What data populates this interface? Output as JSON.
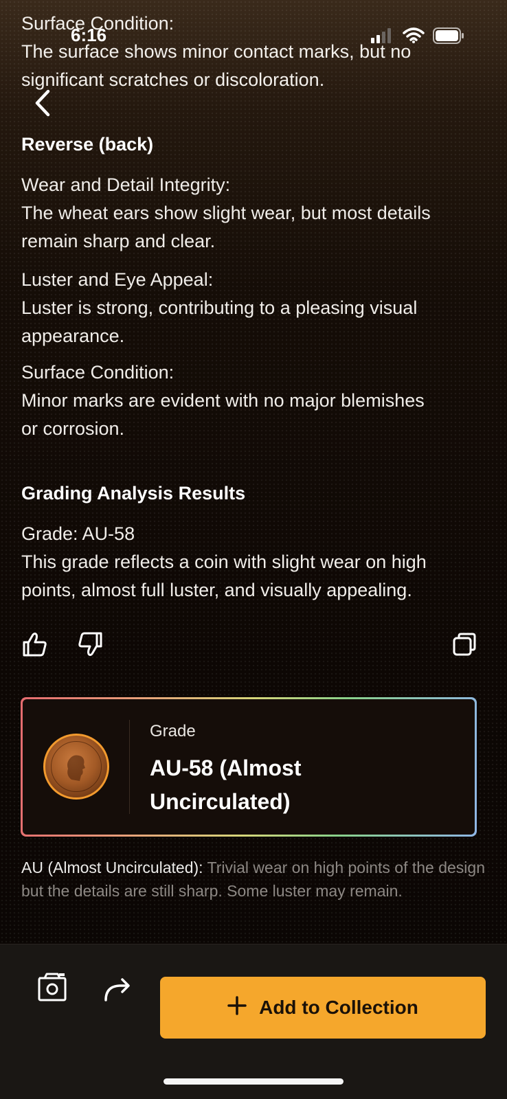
{
  "status_bar": {
    "time": "6:16"
  },
  "top_fragment": {
    "heading": "Surface Condition:",
    "lines": [
      "The surface shows minor contact marks, but no",
      "significant scratches or discoloration."
    ]
  },
  "reverse": {
    "title": "Reverse (back)",
    "wear": {
      "heading": "Wear and Detail Integrity:",
      "lines": [
        "The wheat ears show slight wear, but most details",
        "remain sharp and clear."
      ]
    },
    "luster": {
      "heading": "Luster and Eye Appeal:",
      "lines": [
        "Luster is strong, contributing to a pleasing visual",
        "appearance."
      ]
    },
    "surface": {
      "heading": "Surface Condition:",
      "lines": [
        "Minor marks are evident with no major blemishes",
        "or corrosion."
      ]
    }
  },
  "results": {
    "title": "Grading Analysis Results",
    "grade_line": "Grade: AU-58",
    "lines": [
      "This grade reflects a coin with slight wear on high",
      "points, almost full luster, and visually appealing."
    ]
  },
  "feedback": {
    "like_icon": "thumbs-up-icon",
    "dislike_icon": "thumbs-down-icon",
    "copy_icon": "copy-icon"
  },
  "grade_card": {
    "label": "Grade",
    "value": "AU-58 (Almost Uncirculated)",
    "border_colors": [
      "#e56b6f",
      "#e8a07a",
      "#d6d67a",
      "#89d18a",
      "#8fb6e6"
    ]
  },
  "au_description": {
    "lead": "AU (Almost Uncirculated):",
    "text": " Trivial wear on high points of the design but the details are still sharp. Some luster may remain."
  },
  "bottom_bar": {
    "scan_icon": "camera-scan-icon",
    "share_icon": "share-arrow-icon",
    "add_label": "Add to Collection",
    "add_icon": "plus-icon"
  },
  "colors": {
    "accent": "#f5a72c",
    "background": "#0d0704"
  }
}
